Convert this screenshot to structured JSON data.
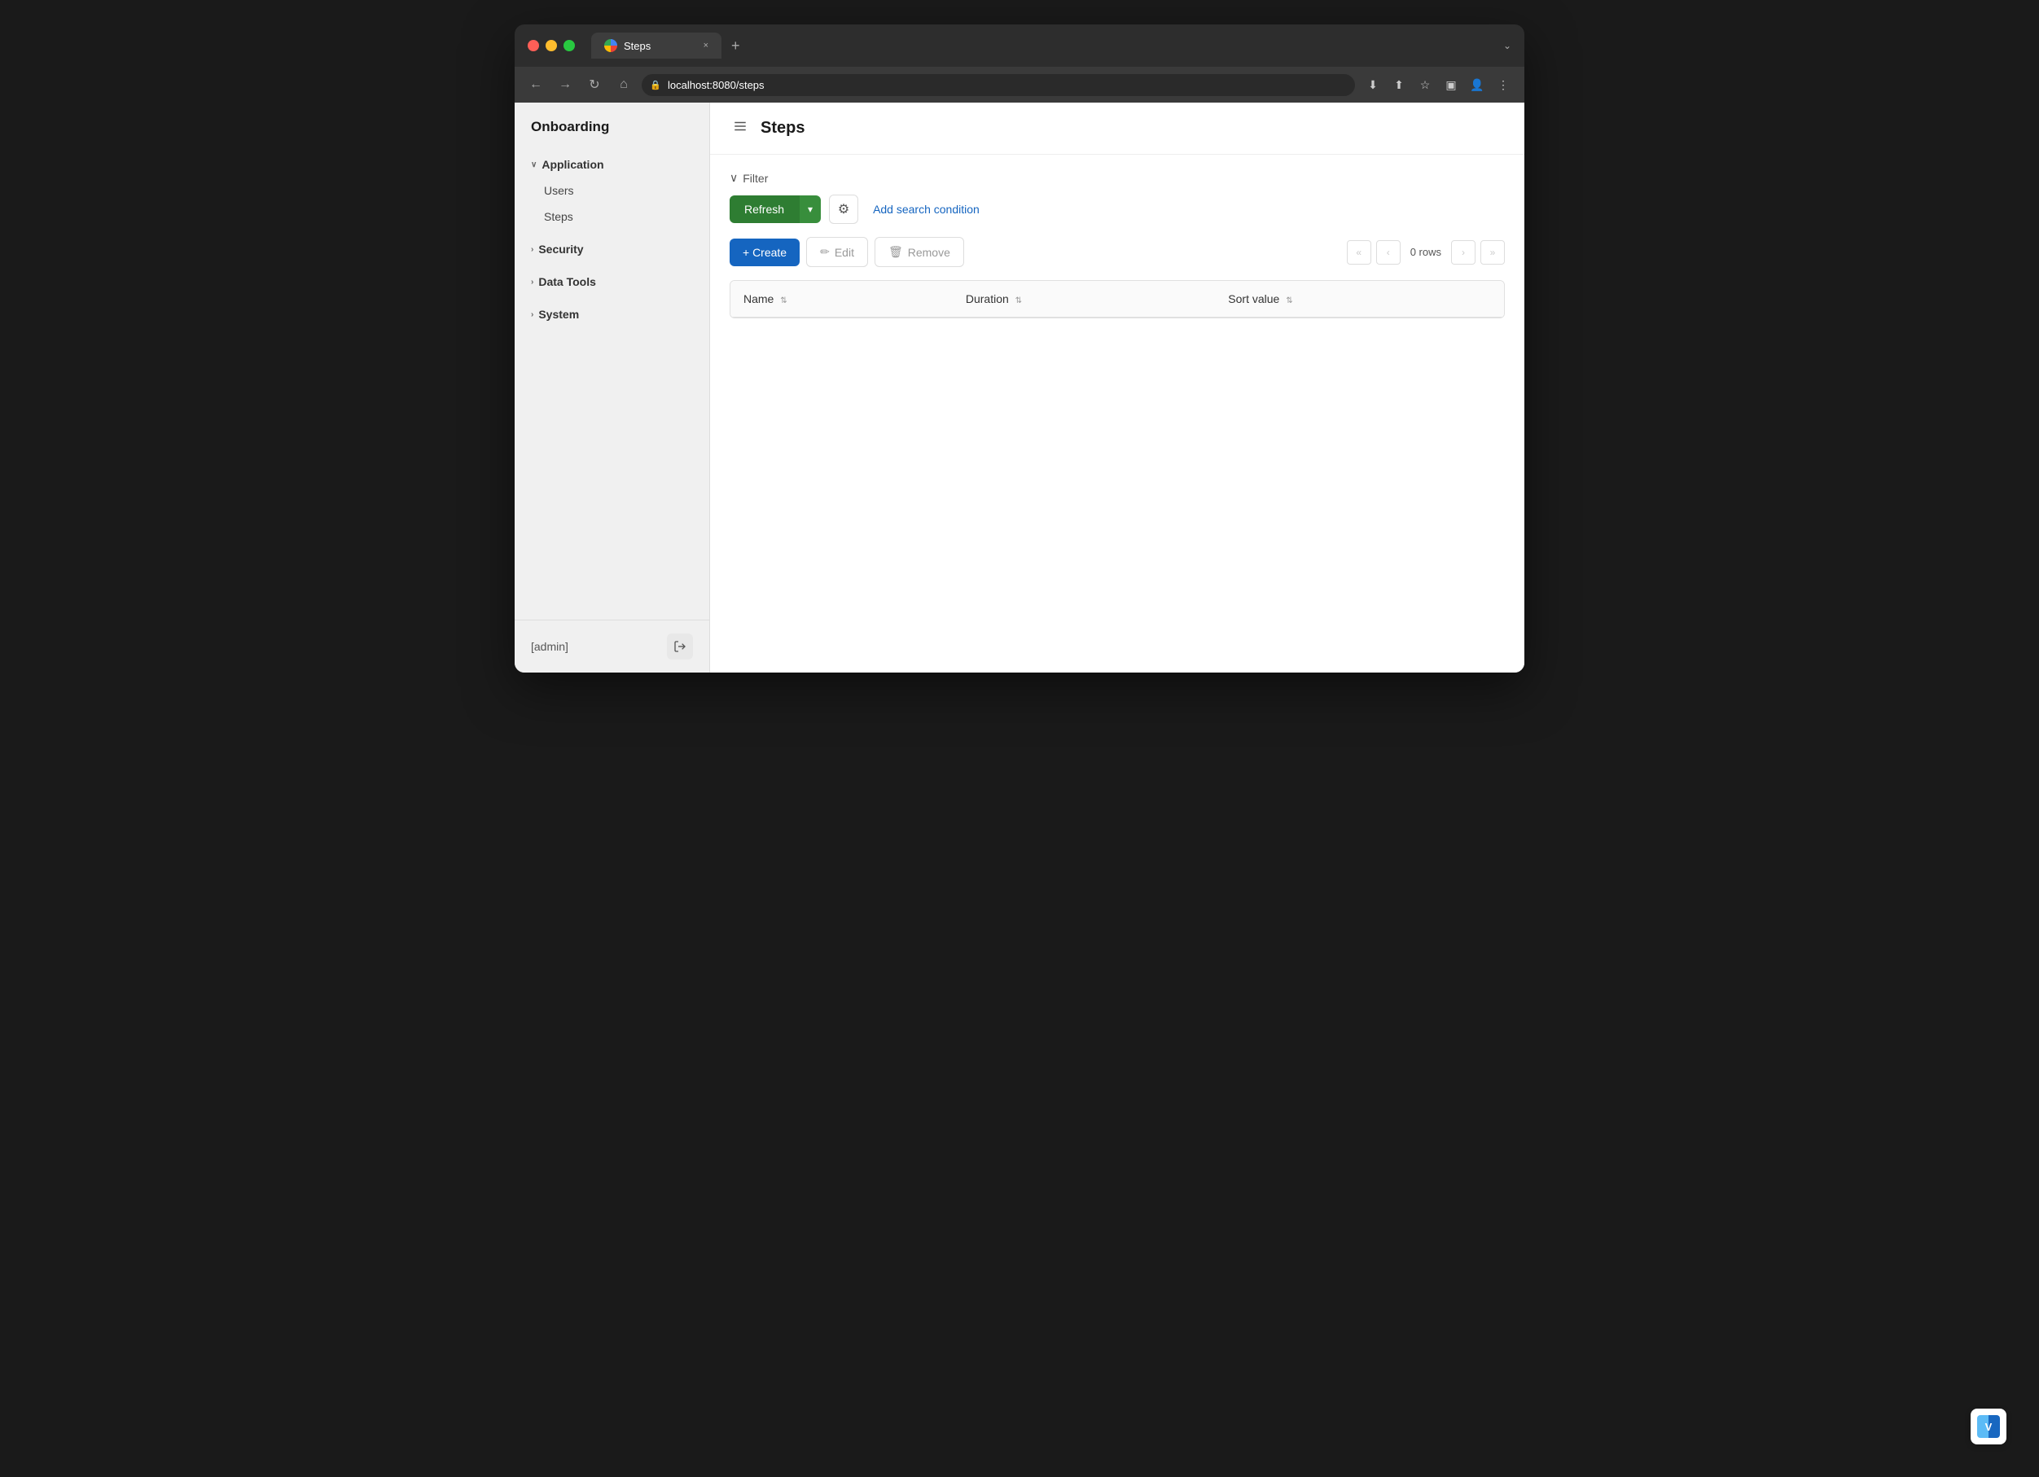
{
  "browser": {
    "tab_title": "Steps",
    "tab_url": "localhost:8080/steps",
    "tab_close_label": "×",
    "tab_new_label": "+",
    "tab_dropdown_label": "⌄",
    "nav_back": "←",
    "nav_forward": "→",
    "nav_reload": "↻",
    "nav_home": "⌂",
    "toolbar_icons": {
      "download": "⬇",
      "share": "⬆",
      "bookmark": "☆",
      "sidebar": "▣",
      "profile": "👤",
      "menu": "⋮"
    }
  },
  "sidebar": {
    "app_name": "Onboarding",
    "sections": [
      {
        "id": "application",
        "label": "Application",
        "expanded": true,
        "items": [
          {
            "id": "users",
            "label": "Users"
          },
          {
            "id": "steps",
            "label": "Steps"
          }
        ]
      },
      {
        "id": "security",
        "label": "Security",
        "expanded": false,
        "items": []
      },
      {
        "id": "data-tools",
        "label": "Data Tools",
        "expanded": false,
        "items": []
      },
      {
        "id": "system",
        "label": "System",
        "expanded": false,
        "items": []
      }
    ],
    "footer": {
      "username": "[admin]",
      "logout_icon": "→"
    }
  },
  "main": {
    "page_title": "Steps",
    "filter": {
      "label": "Filter",
      "chevron": "∨"
    },
    "toolbar": {
      "refresh_label": "Refresh",
      "dropdown_icon": "▾",
      "settings_icon": "⚙",
      "add_condition_label": "Add search condition",
      "create_label": "+ Create",
      "edit_label": "Edit",
      "edit_icon": "✏",
      "remove_label": "Remove",
      "remove_icon": "🗑",
      "rows_count": "0 rows",
      "first_page_icon": "«",
      "prev_page_icon": "‹",
      "next_page_icon": "›",
      "last_page_icon": "»"
    },
    "table": {
      "columns": [
        {
          "id": "name",
          "label": "Name",
          "sort_icon": "⇅"
        },
        {
          "id": "duration",
          "label": "Duration",
          "sort_icon": "⇅"
        },
        {
          "id": "sort_value",
          "label": "Sort value",
          "sort_icon": "⇅"
        }
      ],
      "rows": []
    }
  }
}
